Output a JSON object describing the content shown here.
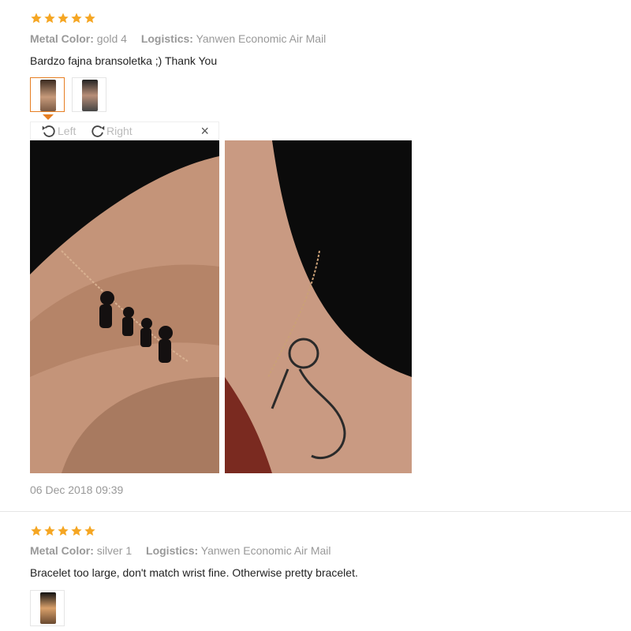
{
  "reviews": [
    {
      "rating": 5,
      "meta": {
        "color_key": "Metal Color:",
        "color_val": "gold 4",
        "log_key": "Logistics:",
        "log_val": "Yanwen Economic Air Mail"
      },
      "text": "Bardzo fajna bransoletka ;) Thank You",
      "thumbnails": [
        "photo-1",
        "photo-2"
      ],
      "viewer": {
        "left_label": "Left",
        "right_label": "Right",
        "close_label": "×"
      },
      "date": "06 Dec 2018 09:39"
    },
    {
      "rating": 5,
      "meta": {
        "color_key": "Metal Color:",
        "color_val": "silver 1",
        "log_key": "Logistics:",
        "log_val": "Yanwen Economic Air Mail"
      },
      "text": "Bracelet too large, don't match wrist fine. Otherwise pretty bracelet.",
      "thumbnails": [
        "photo-1"
      ]
    }
  ],
  "colors": {
    "star": "#f5a623",
    "accent": "#e67e22",
    "muted": "#999999"
  }
}
